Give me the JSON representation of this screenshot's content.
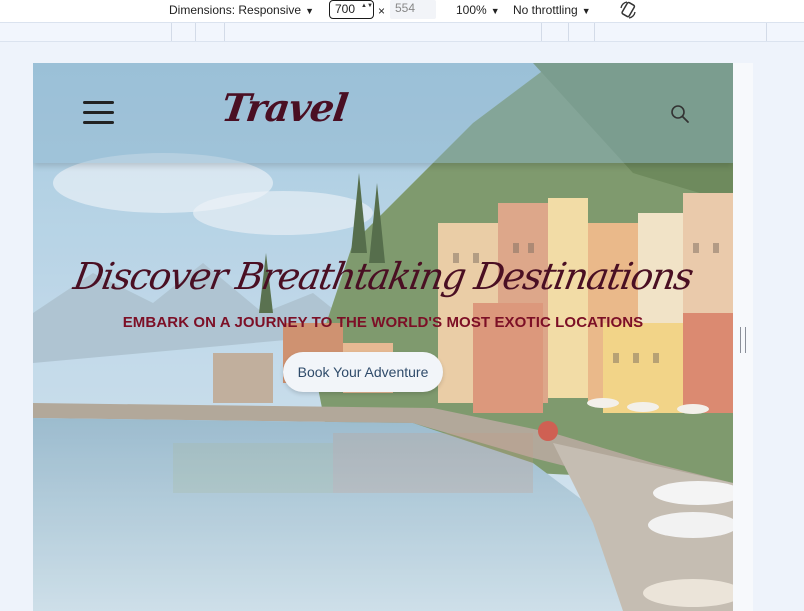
{
  "devtools": {
    "dimensions_label": "Dimensions: Responsive",
    "width": "700",
    "times": "×",
    "height_placeholder": "554",
    "zoom": "100%",
    "throttling": "No throttling",
    "caret": "▼",
    "spin": "▲▼"
  },
  "site": {
    "logo": "Travel",
    "hero": {
      "title": "Discover Breathtaking Destinations",
      "subtitle": "EMBARK ON A JOURNEY TO THE WORLD'S MOST EXOTIC LOCATIONS",
      "cta": "Book Your Adventure"
    }
  },
  "colors": {
    "title": "#4a0f23",
    "subtitle": "#7c0f26",
    "button_text": "#2f4b6a"
  }
}
